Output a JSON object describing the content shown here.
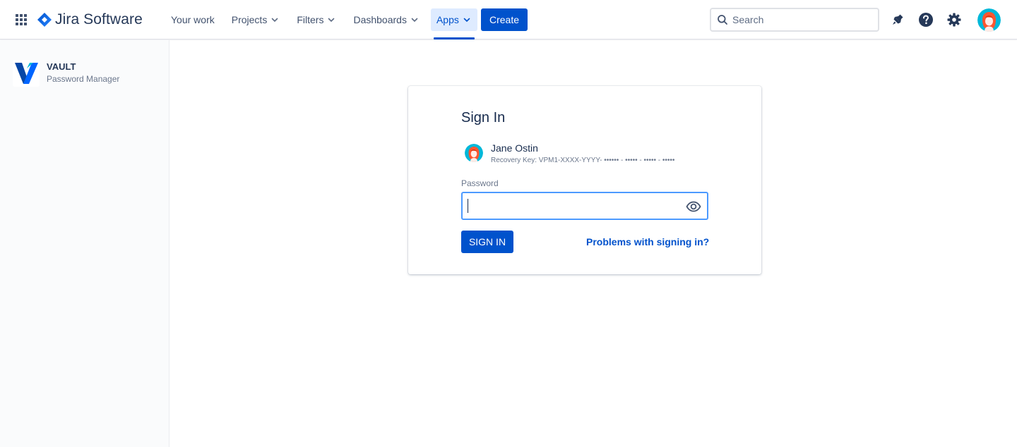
{
  "header": {
    "brand": "Jira Software",
    "nav": [
      {
        "label": "Your work",
        "dropdown": false
      },
      {
        "label": "Projects",
        "dropdown": true
      },
      {
        "label": "Filters",
        "dropdown": true
      },
      {
        "label": "Dashboards",
        "dropdown": true
      },
      {
        "label": "Apps",
        "dropdown": true,
        "active": true
      }
    ],
    "create_label": "Create",
    "search_placeholder": "Search",
    "icons": [
      "app-switcher-icon",
      "notification-icon",
      "help-icon",
      "settings-icon"
    ],
    "accent_color": "#0052cc"
  },
  "sidebar": {
    "app_title": "VAULT",
    "app_subtitle": "Password Manager"
  },
  "signin": {
    "title": "Sign In",
    "user_name": "Jane Ostin",
    "recovery_key": "Recovery Key: VPM1-XXXX-YYYY- •••••• - ••••• - ••••• - •••••",
    "password_label": "Password",
    "password_value": "",
    "signin_button": "SIGN IN",
    "problems_link": "Problems with signing in?"
  }
}
